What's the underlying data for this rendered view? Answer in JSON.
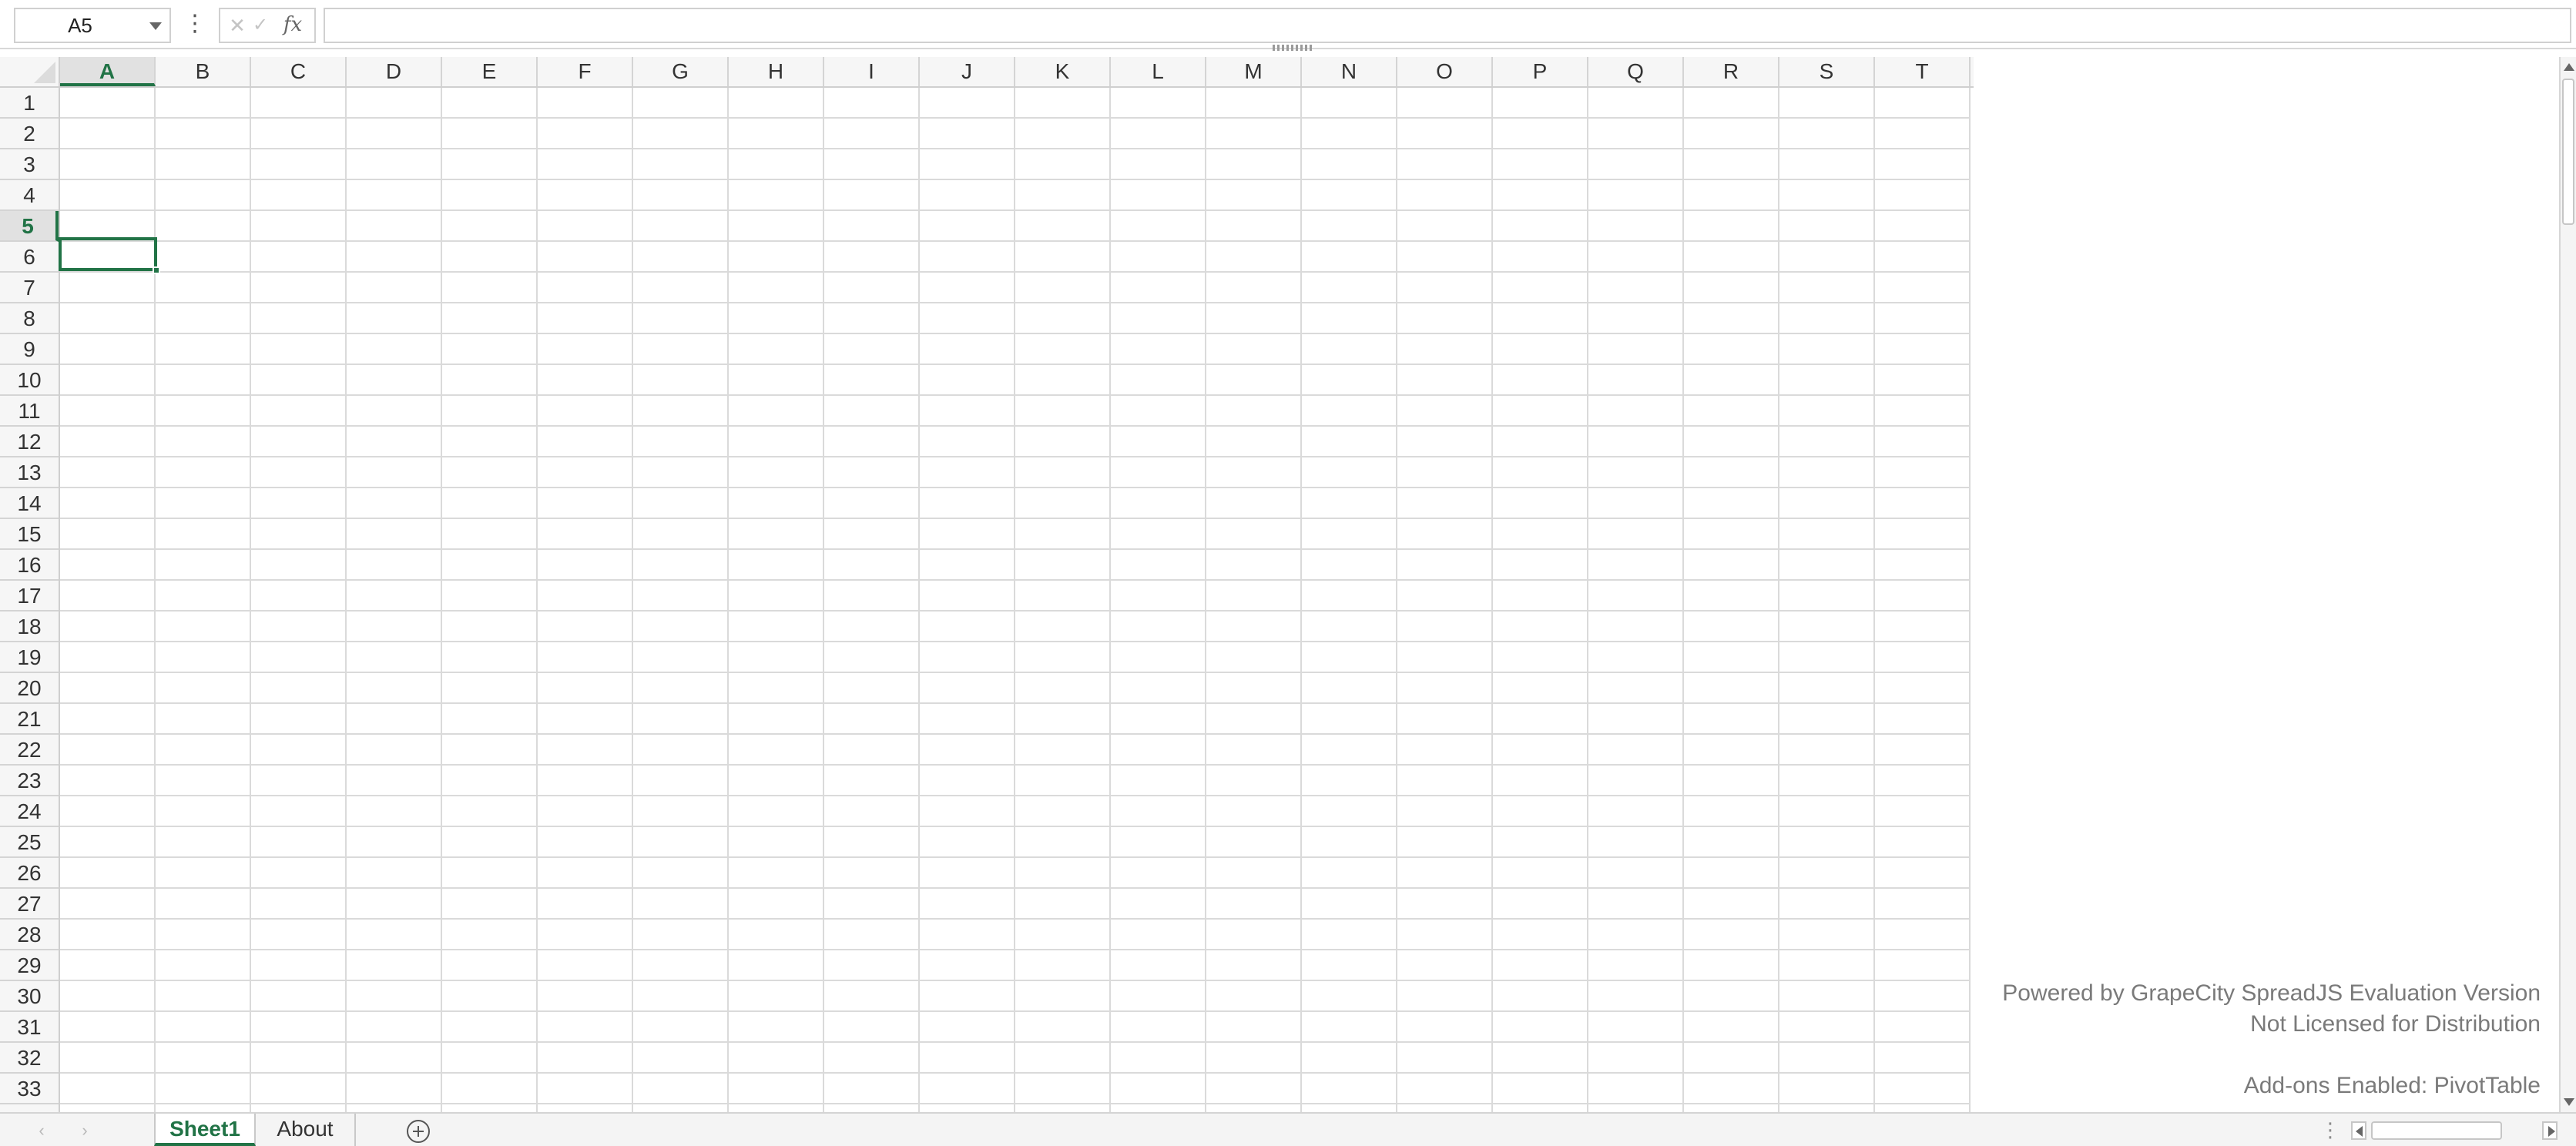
{
  "formula_bar": {
    "name_box_value": "A5",
    "more_glyph": "⋮",
    "cancel_glyph": "✕",
    "enter_glyph": "✓",
    "fx_label": "fx",
    "formula_value": ""
  },
  "grid": {
    "columns": [
      "A",
      "B",
      "C",
      "D",
      "E",
      "F",
      "G",
      "H",
      "I",
      "J",
      "K",
      "L",
      "M",
      "N",
      "O",
      "P",
      "Q",
      "R",
      "S",
      "T"
    ],
    "rows": [
      "1",
      "2",
      "3",
      "4",
      "5",
      "6",
      "7",
      "8",
      "9",
      "10",
      "11",
      "12",
      "13",
      "14",
      "15",
      "16",
      "17",
      "18",
      "19",
      "20",
      "21",
      "22",
      "23",
      "24",
      "25",
      "26",
      "27",
      "28",
      "29",
      "30",
      "31",
      "32",
      "33"
    ],
    "active_column": "A",
    "active_row": "5"
  },
  "watermark": {
    "line1": "Powered by GrapeCity SpreadJS Evaluation Version",
    "line2": "Not Licensed for Distribution",
    "line3": "Add-ons Enabled: PivotTable"
  },
  "tabs": {
    "prev_glyph": "‹",
    "next_glyph": "›",
    "sheets": [
      "Sheet1",
      "About"
    ],
    "active": "Sheet1",
    "splitter_glyph": "⋮"
  },
  "colors": {
    "accent": "#217346",
    "header_bg": "#f6f6f6",
    "gridline": "#dadada",
    "watermark_text": "#7a7a7a"
  }
}
